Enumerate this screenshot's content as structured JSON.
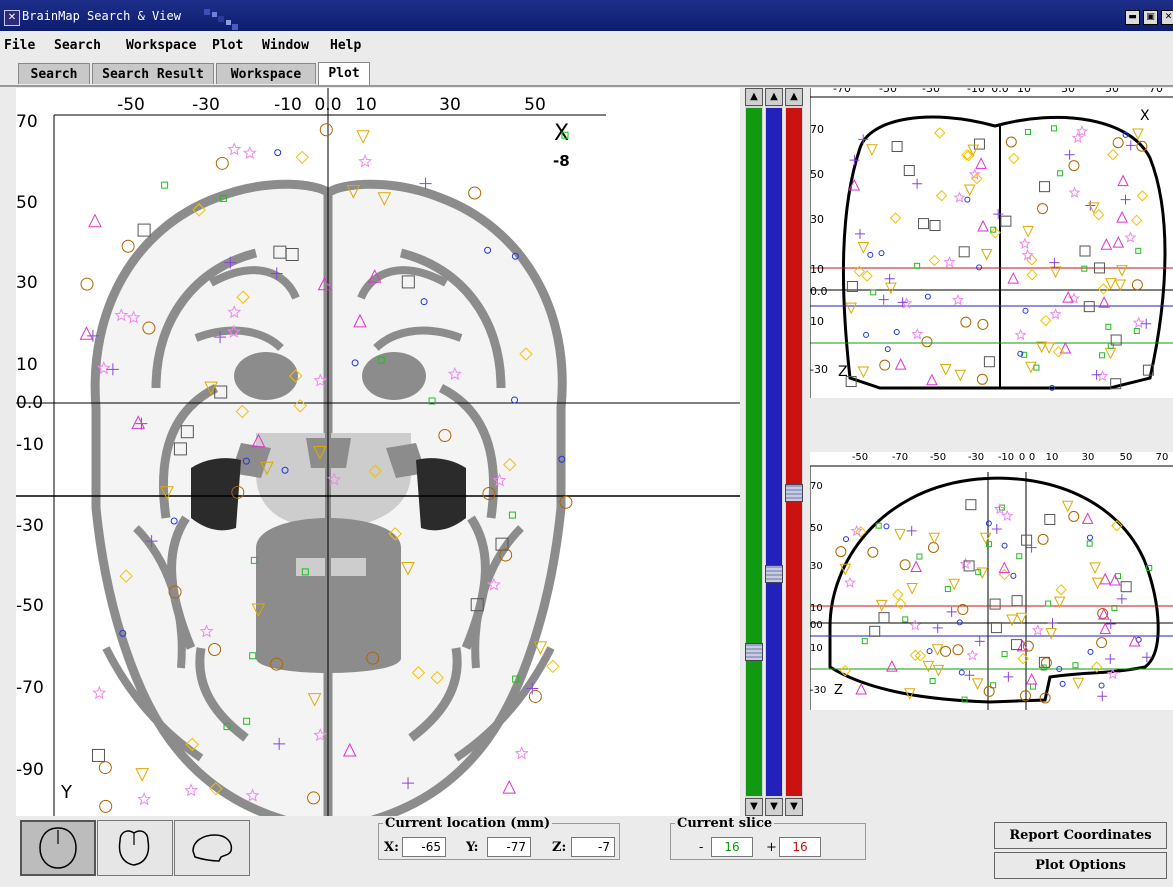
{
  "window": {
    "title": "BrainMap Search & View",
    "app_icon": "x-close-icon",
    "controls": [
      "minimize-icon",
      "maximize-icon",
      "close-icon"
    ]
  },
  "menu": [
    "File",
    "Search",
    "Workspace",
    "Plot",
    "Window",
    "Help"
  ],
  "tabs": [
    {
      "label": "Search",
      "active": false
    },
    {
      "label": "Search Result",
      "active": false
    },
    {
      "label": "Workspace",
      "active": false
    },
    {
      "label": "Plot",
      "active": true
    }
  ],
  "axial": {
    "x_ticks": [
      "-50",
      "-30",
      "-10",
      "0.0",
      "10",
      "30",
      "50"
    ],
    "y_ticks": [
      "70",
      "50",
      "30",
      "10",
      "0.0",
      "-10",
      "-30",
      "-50",
      "-70",
      "-90"
    ],
    "corner_x": "X",
    "corner_y": "Y",
    "slice_value": "-8"
  },
  "coronal": {
    "x_ticks": [
      "-70",
      "-50",
      "-30",
      "-10",
      "0.0",
      "10",
      "30",
      "50",
      "70"
    ],
    "y_ticks": [
      "70",
      "50",
      "30",
      "10",
      "0.0",
      "10",
      "-30"
    ],
    "corner_x": "X",
    "corner_z": "Z"
  },
  "sagittal": {
    "x_ticks": [
      "-50",
      "-70",
      "-50",
      "-30",
      "-10",
      "0",
      "0",
      "10",
      "30",
      "50",
      "70"
    ],
    "y_ticks": [
      "70",
      "50",
      "30",
      "10",
      "00",
      "10",
      "-30"
    ],
    "corner_z": "Z"
  },
  "scrollbars": {
    "colors": {
      "green": "#119911",
      "blue": "#2222bb",
      "red": "#cc1111"
    },
    "arrow_up": "▲",
    "arrow_down": "▼"
  },
  "bottom": {
    "view_buttons": [
      {
        "name": "axial-view",
        "active": true
      },
      {
        "name": "coronal-view",
        "active": false
      },
      {
        "name": "sagittal-view",
        "active": false
      }
    ],
    "location": {
      "legend": "Current location (mm)",
      "x_label": "X:",
      "x": "-65",
      "y_label": "Y:",
      "y": "-77",
      "z_label": "Z:",
      "z": "-7"
    },
    "slice": {
      "legend": "Current slice",
      "minus_label": "-",
      "minus_value": "16",
      "plus_label": "+",
      "plus_value": "16"
    },
    "report_button": "Report Coordinates",
    "options_button": "Plot Options"
  },
  "colors": {
    "titlebar": "#13237a",
    "brain_dark": "#8c8c8c",
    "brain_mid": "#a8a8a8",
    "brain_light": "#cdcdcd",
    "brain_bg": "#f4f4f4"
  }
}
